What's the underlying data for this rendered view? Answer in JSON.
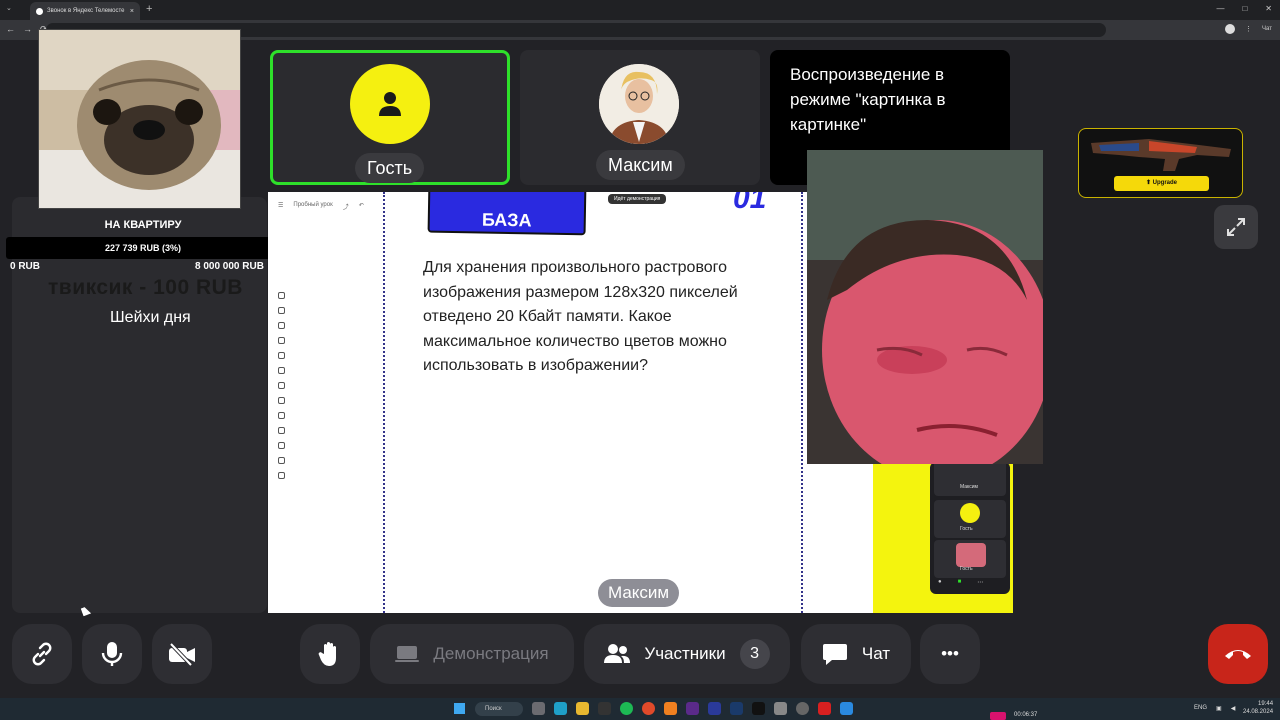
{
  "browser": {
    "tab_title": "Звонок в Яндекс Телемосте",
    "tab_close": "×",
    "new_tab": "+",
    "tab_menu": "⌄",
    "window_controls": [
      "—",
      "□",
      "✕"
    ],
    "nav": [
      "←",
      "→",
      "⟳"
    ],
    "chat_label": "Чат"
  },
  "overlay": {
    "goal_title": "НА КВАРТИРУ",
    "goal_progress": "227 739 RUB (3%)",
    "goal_fraction": 0.03,
    "goal_min": "0 RUB",
    "goal_max": "8 000 000 RUB",
    "donation": "твиксик - 100 RUB",
    "donation_text": "Шейхи дня"
  },
  "tiles": {
    "guest_name": "Гость",
    "maksim_name": "Максим",
    "pip_text": "Воспроизведение в режиме \"картинка в картинке\""
  },
  "ad": {
    "button": "Upgrade"
  },
  "share": {
    "doc_title": "Пробный урок",
    "badge": "БАЗА",
    "number": "01",
    "demo_label": "Идёт демонстрация",
    "task": "Для хранения произвольного растрового изображения размером 128x320 пикселей отведено 20 Кбайт памяти. Какое максимальное количество цветов можно использовать в изображении?",
    "speaker": "Максим",
    "mini_names": [
      "Максим",
      "Гость",
      "Гость"
    ]
  },
  "controls": {
    "demo": "Демонстрация",
    "participants": "Участники",
    "participants_count": "3",
    "chat": "Чат",
    "more": "•••"
  },
  "taskbar": {
    "search": "Поиск",
    "timer": "00:06:37",
    "lang": "ENG",
    "time": "19:44",
    "date": "24.08.2024"
  },
  "colors": {
    "accent_green": "#2ee02a",
    "avatar_yellow": "#f5f010",
    "hangup_red": "#c8251a",
    "badge_blue": "#2a2ae0"
  }
}
